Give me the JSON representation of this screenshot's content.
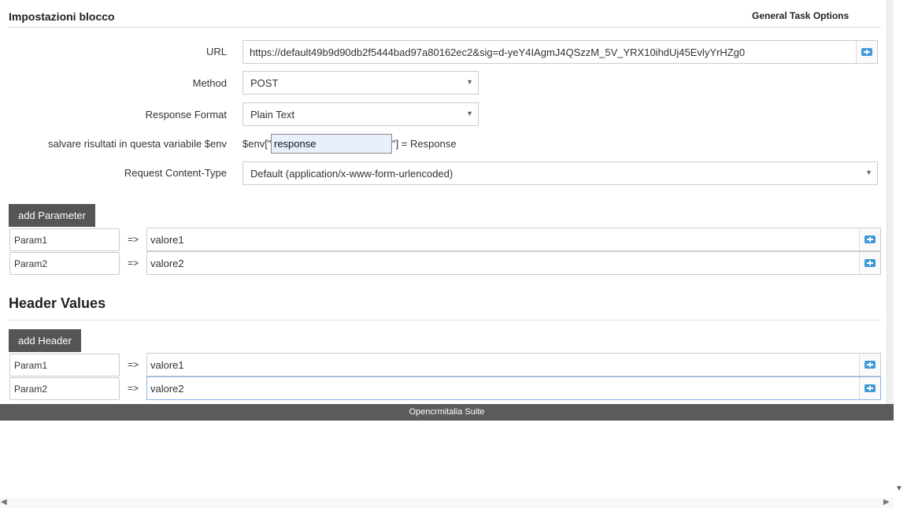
{
  "header": {
    "block_title": "Impostazioni blocco",
    "general_options": "General Task Options"
  },
  "form": {
    "url_label": "URL",
    "url_value": "https://default49b9d90db2f5444bad97a80162ec2&sig=d-yeY4IAgmJ4QSzzM_5V_YRX10ihdUj45EvlyYrHZg0",
    "method_label": "Method",
    "method_value": "POST",
    "response_format_label": "Response Format",
    "response_format_value": "Plain Text",
    "env_label": "salvare risultati in questa variabile $env",
    "env_prefix": "$env[\"",
    "env_value": "response",
    "env_suffix": "\"] = Response",
    "content_type_label": "Request Content-Type",
    "content_type_value": "Default (application/x-www-form-urlencoded)"
  },
  "parameters": {
    "add_label": "add Parameter",
    "rows": [
      {
        "key": "Param1",
        "arrow": "=>",
        "value": "valore1"
      },
      {
        "key": "Param2",
        "arrow": "=>",
        "value": "valore2"
      }
    ]
  },
  "headers": {
    "title": "Header Values",
    "add_label": "add Header",
    "rows": [
      {
        "key": "Param1",
        "arrow": "=>",
        "value": "valore1"
      },
      {
        "key": "Param2",
        "arrow": "=>",
        "value": "valore2"
      }
    ]
  },
  "footer": {
    "text": "Opencrmitalia Suite"
  },
  "icons": {
    "value_picker": "field-picker-icon",
    "dropdown": "chevron-down-icon",
    "scroll_down": "scroll-down-icon",
    "scroll_left": "scroll-left-icon",
    "scroll_right": "scroll-right-icon"
  }
}
